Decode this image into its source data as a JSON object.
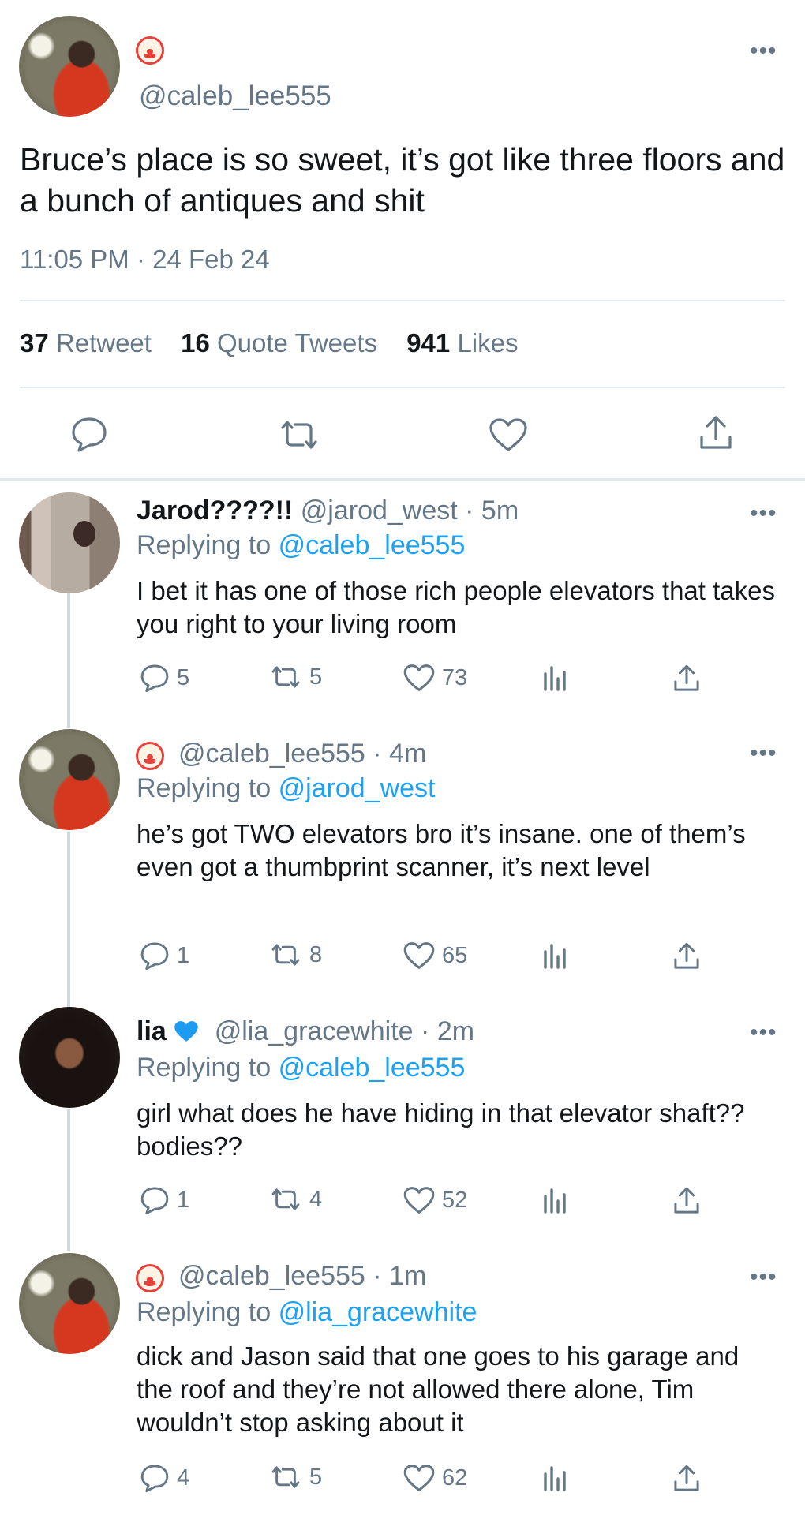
{
  "main_tweet": {
    "handle": "@caleb_lee555",
    "text": "Bruce’s place is so sweet, it’s got like three floors and a bunch of antiques and shit",
    "timestamp": "11:05 PM · 24 Feb 24",
    "stats": {
      "retweets_count": "37",
      "retweets_label": "Retweet",
      "quotes_count": "16",
      "quotes_label": "Quote Tweets",
      "likes_count": "941",
      "likes_label": "Likes"
    },
    "more_label": "•••"
  },
  "replies": [
    {
      "name": "Jarod????!!",
      "handle": "@jarod_west",
      "time": "· 5m",
      "replying_prefix": "Replying to",
      "replying_to": "@caleb_lee555",
      "text": "I bet it has one of those rich people elevators that takes you right to your living room",
      "replies": "5",
      "retweets": "5",
      "likes": "73",
      "more_label": "•••"
    },
    {
      "name": "",
      "handle": "@caleb_lee555",
      "time": "· 4m",
      "replying_prefix": "Replying to",
      "replying_to": "@jarod_west",
      "text": "he’s got TWO elevators bro it’s insane. one of them’s even got a thumbprint scanner, it’s next level",
      "replies": "1",
      "retweets": "8",
      "likes": "65",
      "more_label": "•••"
    },
    {
      "name": "lia",
      "handle": "@lia_gracewhite",
      "time": "· 2m",
      "replying_prefix": "Replying to",
      "replying_to": "@caleb_lee555",
      "text": "girl what does he have hiding in that elevator shaft?? bodies??",
      "replies": "1",
      "retweets": "4",
      "likes": "52",
      "more_label": "•••"
    },
    {
      "name": "",
      "handle": "@caleb_lee555",
      "time": "· 1m",
      "replying_prefix": "Replying to",
      "replying_to": "@lia_gracewhite",
      "text": "dick and Jason said that one goes to his garage and the roof and they’re not allowed there alone, Tim wouldn’t stop asking about it",
      "replies": "4",
      "retweets": "5",
      "likes": "62",
      "more_label": "•••"
    }
  ],
  "icons": {
    "clown": "clown-emoji",
    "blue_heart": "blue-heart-emoji",
    "reply": "speech-bubble",
    "retweet": "retweet-arrows",
    "like": "heart-outline",
    "analytics": "bar-chart",
    "share": "share-upload"
  },
  "colors": {
    "link": "#1da1f2",
    "secondary_text": "#657786",
    "primary_text": "#14171a",
    "divider": "#e1e8ed",
    "blue_heart": "#1d9bf0"
  }
}
